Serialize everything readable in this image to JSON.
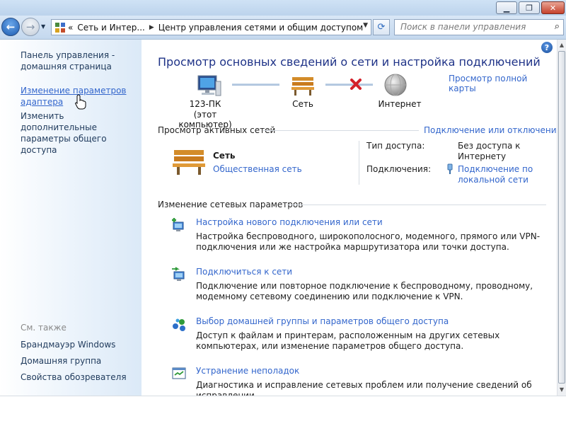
{
  "window": {
    "controls": {
      "min": "▁",
      "max": "❐",
      "close": "✕"
    }
  },
  "nav": {
    "back": "←",
    "forward": "→",
    "address": {
      "prefix": "«",
      "crumb1": "Сеть и Интер...",
      "crumb2": "Центр управления сетями и общим доступом"
    },
    "refresh": "⟳",
    "search_placeholder": "Поиск в панели управления"
  },
  "sidebar": {
    "home": "Панель управления - домашняя страница",
    "adapter": "Изменение параметров адаптера",
    "sharing": "Изменить дополнительные параметры общего доступа",
    "see_also": "См. также",
    "links": [
      "Брандмауэр Windows",
      "Домашняя группа",
      "Свойства обозревателя"
    ]
  },
  "main": {
    "help": "?",
    "title": "Просмотр основных сведений о сети и настройка подключений",
    "full_map": "Просмотр полной карты",
    "map": {
      "computer_name": "123-ПК",
      "computer_sub": "(этот компьютер)",
      "network": "Сеть",
      "internet": "Интернет"
    },
    "active": {
      "header": "Просмотр активных сетей",
      "connect_link": "Подключение или отключение",
      "network_name": "Сеть",
      "network_type": "Общественная сеть",
      "access_label": "Тип доступа:",
      "access_value": "Без доступа к Интернету",
      "connections_label": "Подключения:",
      "connections_value": "Подключение по локальной сети"
    },
    "change": {
      "header": "Изменение сетевых параметров",
      "tasks": [
        {
          "title": "Настройка нового подключения или сети",
          "desc": "Настройка беспроводного, широкополосного, модемного, прямого или VPN-подключения или же настройка маршрутизатора или точки доступа."
        },
        {
          "title": "Подключиться к сети",
          "desc": "Подключение или повторное подключение к беспроводному, проводному, модемному сетевому соединению или подключение к VPN."
        },
        {
          "title": "Выбор домашней группы и параметров общего доступа",
          "desc": "Доступ к файлам и принтерам, расположенным на других сетевых компьютерах, или изменение параметров общего доступа."
        },
        {
          "title": "Устранение неполадок",
          "desc": "Диагностика и исправление сетевых проблем или получение сведений об исправлении."
        }
      ]
    }
  }
}
